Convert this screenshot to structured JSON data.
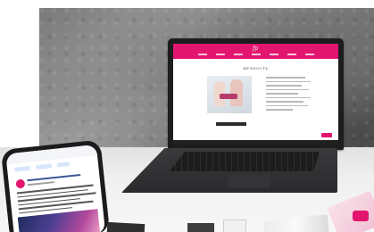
{
  "scene": {
    "brand_color": "#e2166f",
    "laptop": {
      "site_logo": "fp",
      "page_title": "ВЕЧНОСТЬ"
    },
    "icons": [
      "laptop-icon",
      "phone-icon"
    ]
  }
}
